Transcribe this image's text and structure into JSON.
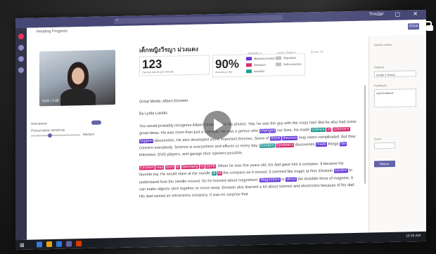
{
  "titlebar": {
    "search_placeholder": "Search",
    "user": "Teacher",
    "window_buttons": "— ▢ ✕"
  },
  "app": {
    "breadcrumb": "Reading Progress",
    "close_label": "Close"
  },
  "video": {
    "time": "0:04 / 1:06"
  },
  "options": {
    "auto_pause_label": "Auto-pause",
    "pronunciation_label": "Pronunciation sensitivity",
    "sensitivity_value": "Medium"
  },
  "student": {
    "name": "เด็กหญิงวีรญา ม่วงแดง"
  },
  "stats": {
    "words_value": "123",
    "words_label": "Correct words per minute",
    "accuracy_value": "90%",
    "accuracy_label": "Accuracy rate"
  },
  "legend": [
    {
      "label": "Mispronunciation",
      "color": "#5b2fd6"
    },
    {
      "label": "Omission",
      "color": "#d6226a"
    },
    {
      "label": "Insertion",
      "color": "#14968f"
    },
    {
      "label": "Repetition",
      "color": "#bbbbbb"
    },
    {
      "label": "Self-correction",
      "color": "#bbbbbb"
    }
  ],
  "meta": {
    "attempts": "Attempts: 1",
    "level": "Level: Grade 4",
    "errors": "Errors: 12"
  },
  "passage": {
    "title": "Great Minds: Albert Einstein",
    "author": "By Lydia Lukidis",
    "p1": [
      [
        "You would probably recognize Albert Einstein from his photos. Yep, he was the guy with the crazy hair! But he also had some great ideas. He was more than just a scientist. He was a genius who ",
        ""
      ],
      [
        "changed",
        "purple"
      ],
      [
        " our lives. He made ",
        ""
      ],
      [
        "science",
        "teal"
      ],
      [
        " ",
        ""
      ],
      [
        "of",
        "pink"
      ],
      [
        " ",
        ""
      ],
      [
        "science's",
        "pink"
      ],
      [
        " ",
        ""
      ],
      [
        "biggest",
        "purple"
      ],
      [
        " discoveries. He also developed some important theories. Some of ",
        ""
      ],
      [
        "these",
        "purple"
      ],
      [
        " ",
        ""
      ],
      [
        "theories",
        "purple"
      ],
      [
        " may seem complicated. But they concern everybody. Science is everywhere and affects us every day. ",
        ""
      ],
      [
        "Einstein",
        "teal"
      ],
      [
        " ",
        ""
      ],
      [
        "Einstein's",
        "pink"
      ],
      [
        " discoveries ",
        ""
      ],
      [
        "made",
        "purple"
      ],
      [
        " things ",
        ""
      ],
      [
        "like",
        "purple"
      ],
      [
        " television, DVD players, and garage door openers possible.",
        ""
      ]
    ],
    "p2": [
      [
        "Einstein",
        "pink"
      ],
      [
        " ",
        ""
      ],
      [
        "was",
        "pink"
      ],
      [
        " ",
        ""
      ],
      [
        "born",
        "pink"
      ],
      [
        " ",
        ""
      ],
      [
        "in",
        "pink"
      ],
      [
        " ",
        ""
      ],
      [
        "Germany",
        "pink"
      ],
      [
        " ",
        ""
      ],
      [
        "in",
        "pink"
      ],
      [
        " ",
        ""
      ],
      [
        "1879",
        "pink"
      ],
      [
        ". When he was five years old, his dad gave him a compass. It became his favorite toy. He would stare at the needle ",
        ""
      ],
      [
        "of",
        "teal"
      ],
      [
        " ",
        ""
      ],
      [
        "of",
        "pink"
      ],
      [
        " the compass as it moved. It seemed like magic at first. Einstein ",
        ""
      ],
      [
        "wanted",
        "purple"
      ],
      [
        " to understand how the needle moved. So he learned about magnetism. ",
        ""
      ],
      [
        "Magnetism",
        "purple"
      ],
      [
        " is ",
        ""
      ],
      [
        "about",
        "purple"
      ],
      [
        " the invisible force of magnets. It can make objects stick together or move away. Einstein also learned a lot about science and electronics because of his dad. His dad owned an electronics company. It was no surprise that",
        ""
      ]
    ]
  },
  "right_pane": {
    "reviewer": "Review status",
    "student_label": "Student",
    "student_value": "Grade 4 Group",
    "feedback_label": "Feedback",
    "feedback_placeholder": "Add feedback",
    "score_label": "Score",
    "return_label": "Return"
  },
  "taskbar": {
    "time": "10:36 AM"
  }
}
